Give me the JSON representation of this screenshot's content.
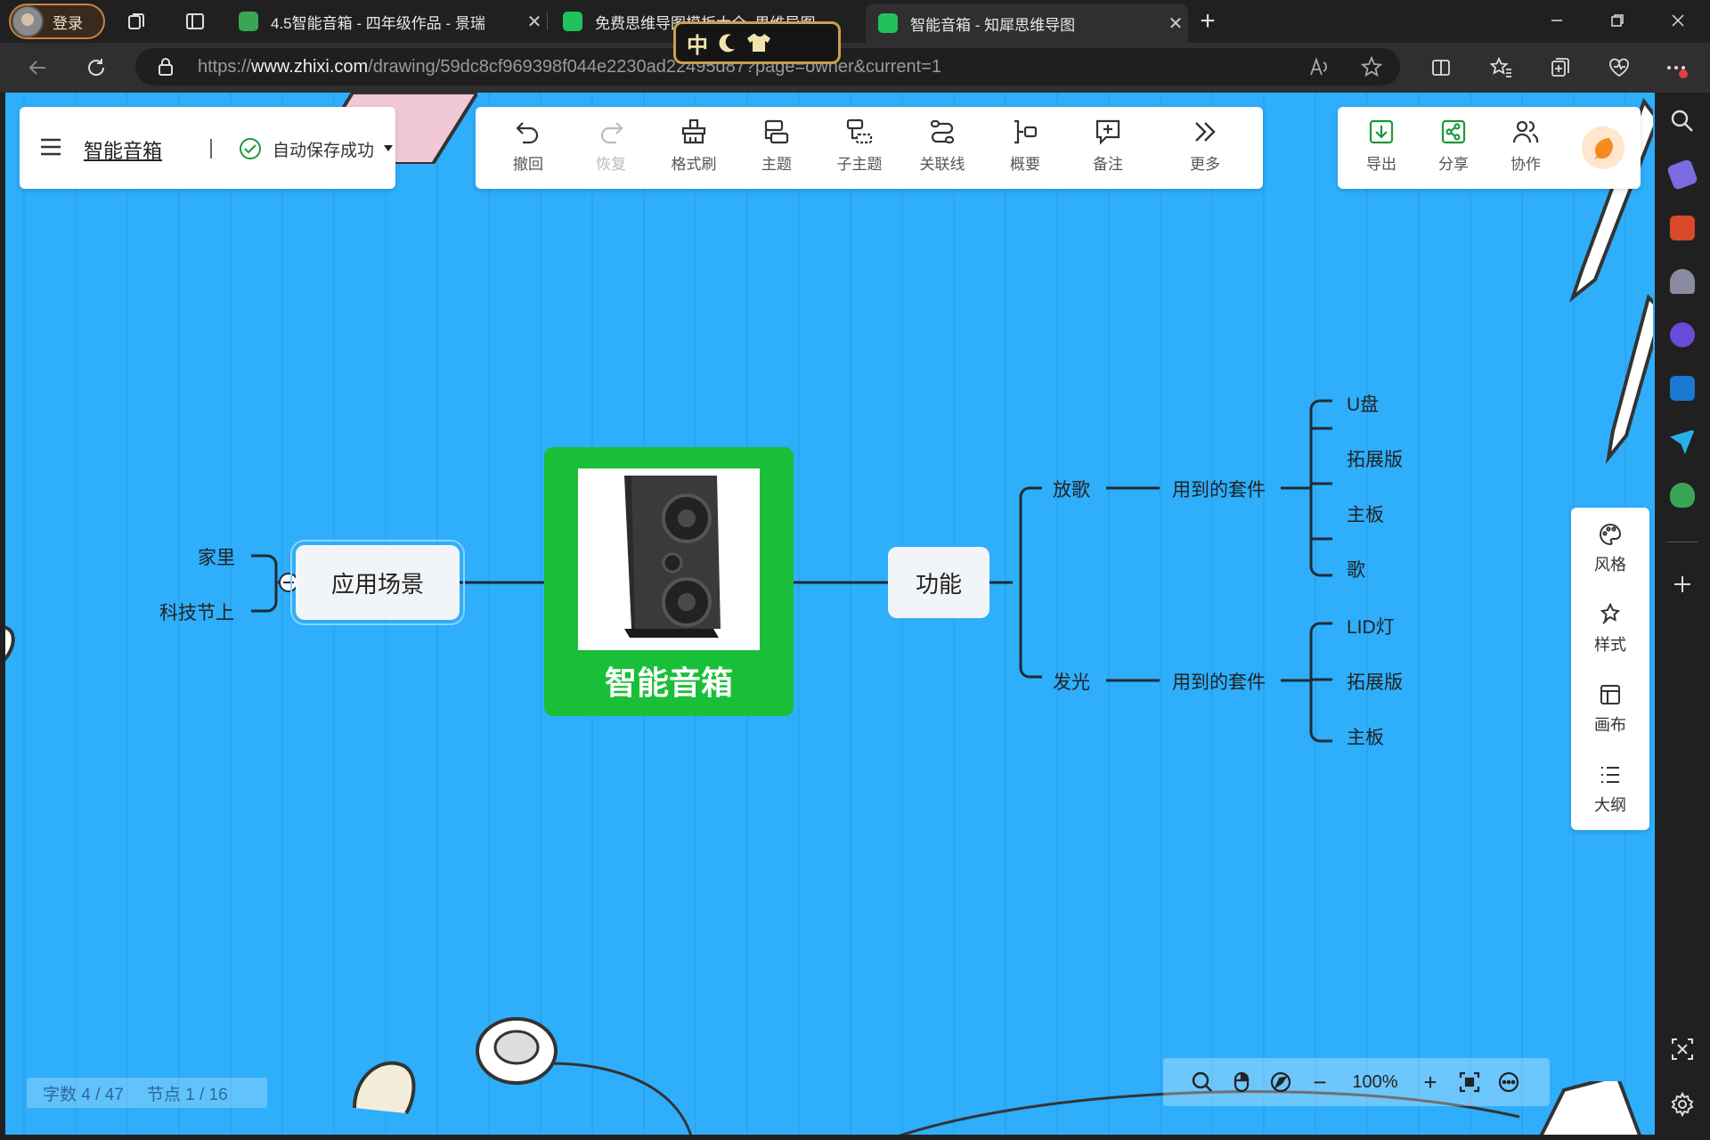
{
  "browser": {
    "profile_label": "登录",
    "tabs": [
      {
        "title": "4.5智能音箱 - 四年级作品 - 景瑞",
        "favicon_color": "#3aa655"
      },
      {
        "title": "免费思维导图模板大全_思维导图",
        "favicon_color": "#21c25b"
      },
      {
        "title": "智能音箱 - 知犀思维导图",
        "favicon_color": "#21c25b"
      }
    ],
    "new_tab": "+",
    "close_glyph": "✕",
    "url_prefix": "https://",
    "url_domain": "www.zhixi.com",
    "url_path": "/drawing/59dc8cf969398f044e2230ad22495d87?page=owner&current=1",
    "ime_label": "中"
  },
  "header": {
    "doc_title": "智能音箱",
    "save_status": "自动保存成功"
  },
  "toolbar": {
    "undo": "撤回",
    "redo": "恢复",
    "format_brush": "格式刷",
    "topic": "主题",
    "subtopic": "子主题",
    "relation": "关联线",
    "summary": "概要",
    "note": "备注",
    "more": "更多"
  },
  "share_panel": {
    "export": "导出",
    "share": "分享",
    "collab": "协作"
  },
  "side_panel": {
    "style_theme": "风格",
    "style": "样式",
    "canvas": "画布",
    "outline": "大纲"
  },
  "mindmap": {
    "root": "智能音箱",
    "left_branch": {
      "label": "应用场景",
      "children": [
        "家里",
        "科技节上"
      ]
    },
    "right_branch": {
      "label": "功能",
      "children": [
        {
          "label": "放歌",
          "sub": "用到的套件",
          "items": [
            "U盘",
            "拓展版",
            "主板",
            "歌"
          ]
        },
        {
          "label": "发光",
          "sub": "用到的套件",
          "items": [
            "LID灯",
            "拓展版",
            "主板"
          ]
        }
      ]
    }
  },
  "status": {
    "word_count": "字数 4 / 47",
    "node_count": "节点 1 / 16"
  },
  "zoom": {
    "level": "100%",
    "minus": "−",
    "plus": "+"
  },
  "colors": {
    "canvas_bg": "#2eaefb",
    "root_bg": "#19bf38",
    "node_bg": "#f2f5f8",
    "line": "#1f2a33"
  }
}
